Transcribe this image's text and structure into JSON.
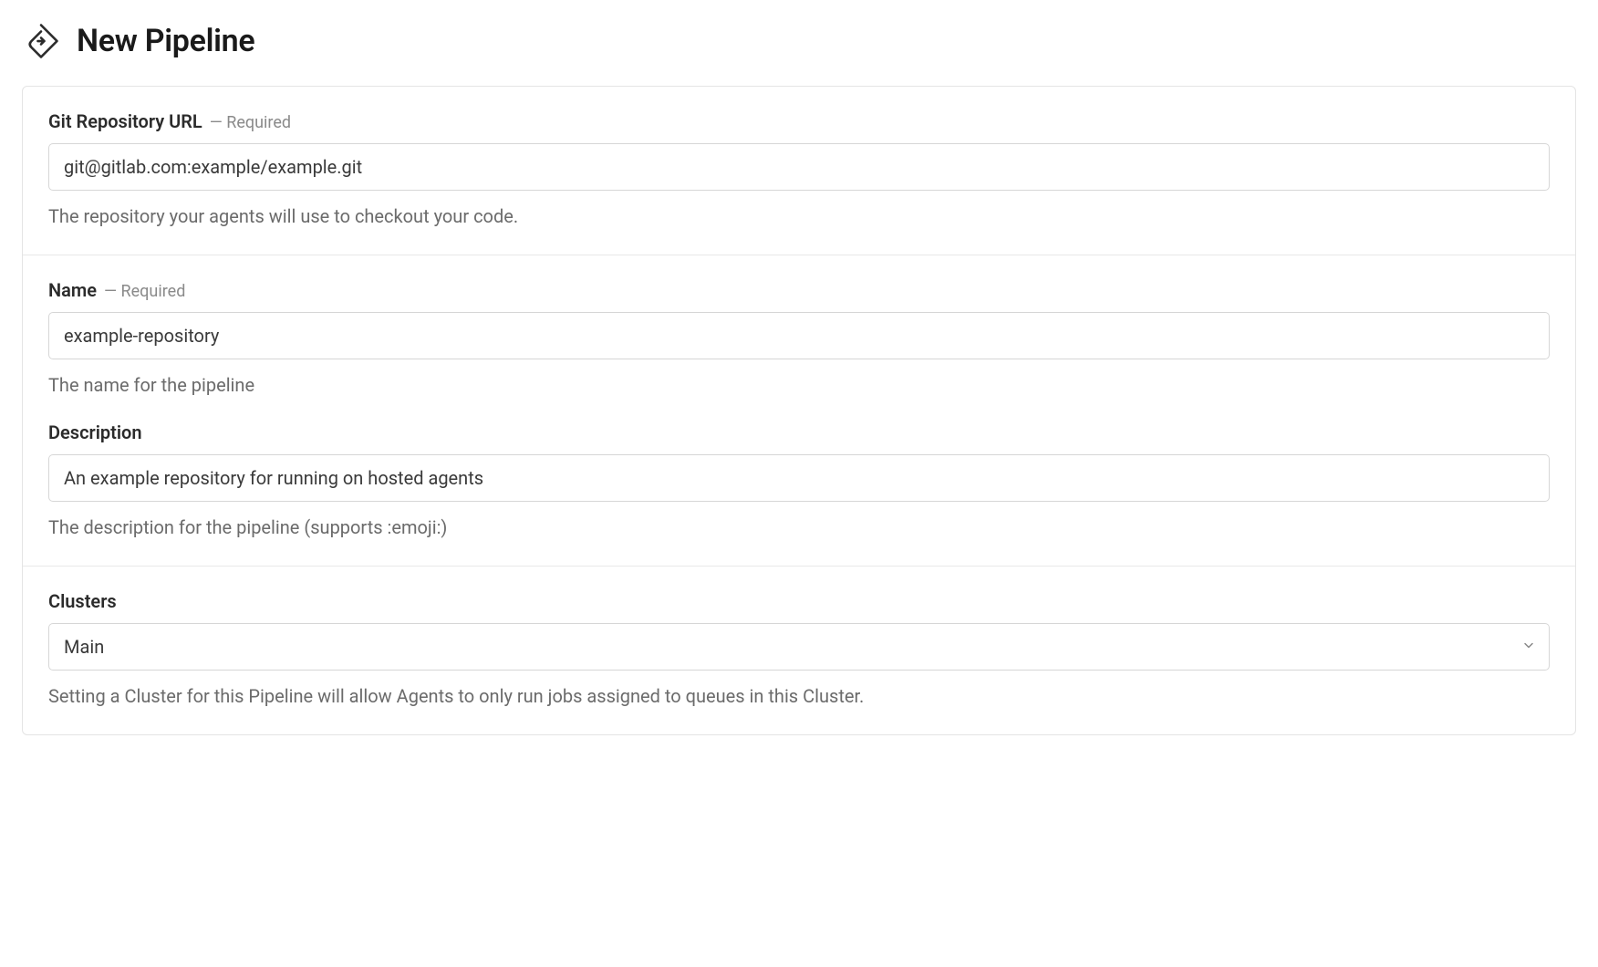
{
  "header": {
    "title": "New Pipeline"
  },
  "fields": {
    "gitRepo": {
      "label": "Git Repository URL",
      "requiredText": "— Required",
      "value": "git@gitlab.com:example/example.git",
      "help": "The repository your agents will use to checkout your code."
    },
    "name": {
      "label": "Name",
      "requiredText": "— Required",
      "value": "example-repository",
      "help": "The name for the pipeline"
    },
    "description": {
      "label": "Description",
      "value": "An example repository for running on hosted agents",
      "help": "The description for the pipeline (supports :emoji:)"
    },
    "clusters": {
      "label": "Clusters",
      "selected": "Main",
      "help": "Setting a Cluster for this Pipeline will allow Agents to only run jobs assigned to queues in this Cluster."
    }
  }
}
